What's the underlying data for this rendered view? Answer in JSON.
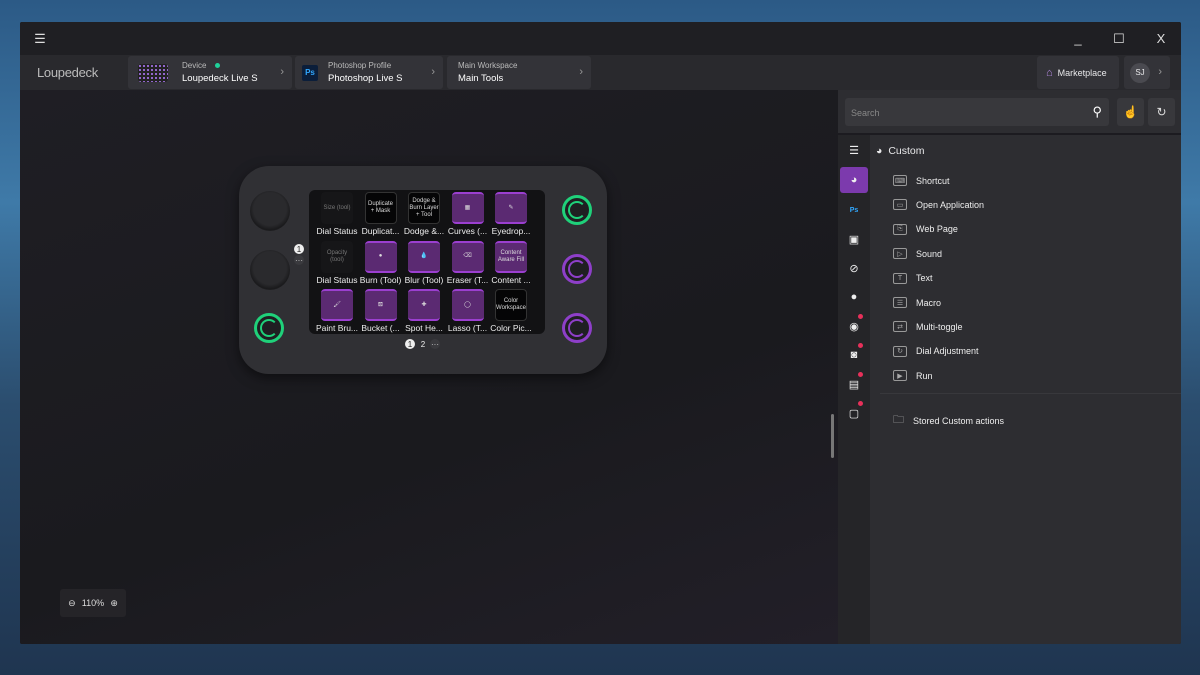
{
  "window": {
    "menu_icon": "☰",
    "minimize": "_",
    "maximize": "☐",
    "close": "X"
  },
  "header": {
    "logo": "Loupedeck",
    "crumbs": [
      {
        "label": "Device",
        "value": "Loupedeck Live S"
      },
      {
        "label": "Photoshop Profile",
        "value": "Photoshop Live S",
        "icon": "Ps"
      },
      {
        "label": "Main Workspace",
        "value": "Main Tools"
      }
    ],
    "marketplace": "Marketplace",
    "avatar": "SJ"
  },
  "device": {
    "tiles": [
      {
        "key": "Size (tool)",
        "label": "Dial Status",
        "style": "dark"
      },
      {
        "key": "Duplicate + Mask",
        "label": "Duplicat...",
        "style": "black"
      },
      {
        "key": "Dodge & Burn Layer + Tool",
        "label": "Dodge &...",
        "style": "black"
      },
      {
        "key": "▦",
        "label": "Curves (...",
        "style": "purple"
      },
      {
        "key": "✎",
        "label": "Eyedrop...",
        "style": "purple"
      },
      {
        "key": "Opacity (tool)",
        "label": "Dial Status",
        "style": "dark"
      },
      {
        "key": "●",
        "label": "Burn (Tool)",
        "style": "purple"
      },
      {
        "key": "💧",
        "label": "Blur (Tool)",
        "style": "purple"
      },
      {
        "key": "⌫",
        "label": "Eraser (T...",
        "style": "purple"
      },
      {
        "key": "Content Aware Fill",
        "label": "Content ...",
        "style": "purple"
      },
      {
        "key": "🖌",
        "label": "Paint Bru...",
        "style": "purple"
      },
      {
        "key": "⛾",
        "label": "Bucket (...",
        "style": "purple"
      },
      {
        "key": "✚",
        "label": "Spot He...",
        "style": "purple"
      },
      {
        "key": "◯",
        "label": "Lasso (T...",
        "style": "purple"
      },
      {
        "key": "Color Workspace",
        "label": "Color Pic...",
        "style": "black"
      }
    ],
    "dial_page": "1",
    "pages": [
      "1",
      "2"
    ],
    "more": "···"
  },
  "zoom": {
    "level": "110%"
  },
  "panel": {
    "search_placeholder": "Search",
    "section_title": "Custom",
    "items": [
      "Shortcut",
      "Open Application",
      "Web Page",
      "Sound",
      "Text",
      "Macro",
      "Multi-toggle",
      "Dial Adjustment",
      "Run"
    ],
    "item_icons": [
      "⌨",
      "▭",
      "⎘",
      "▷",
      "T",
      "☰",
      "⇄",
      "↻",
      "▶"
    ],
    "stored": "Stored Custom actions"
  },
  "colors": {
    "green": "#1fd17a",
    "purple": "#8e3fc9",
    "accent": "#7c3aad"
  }
}
